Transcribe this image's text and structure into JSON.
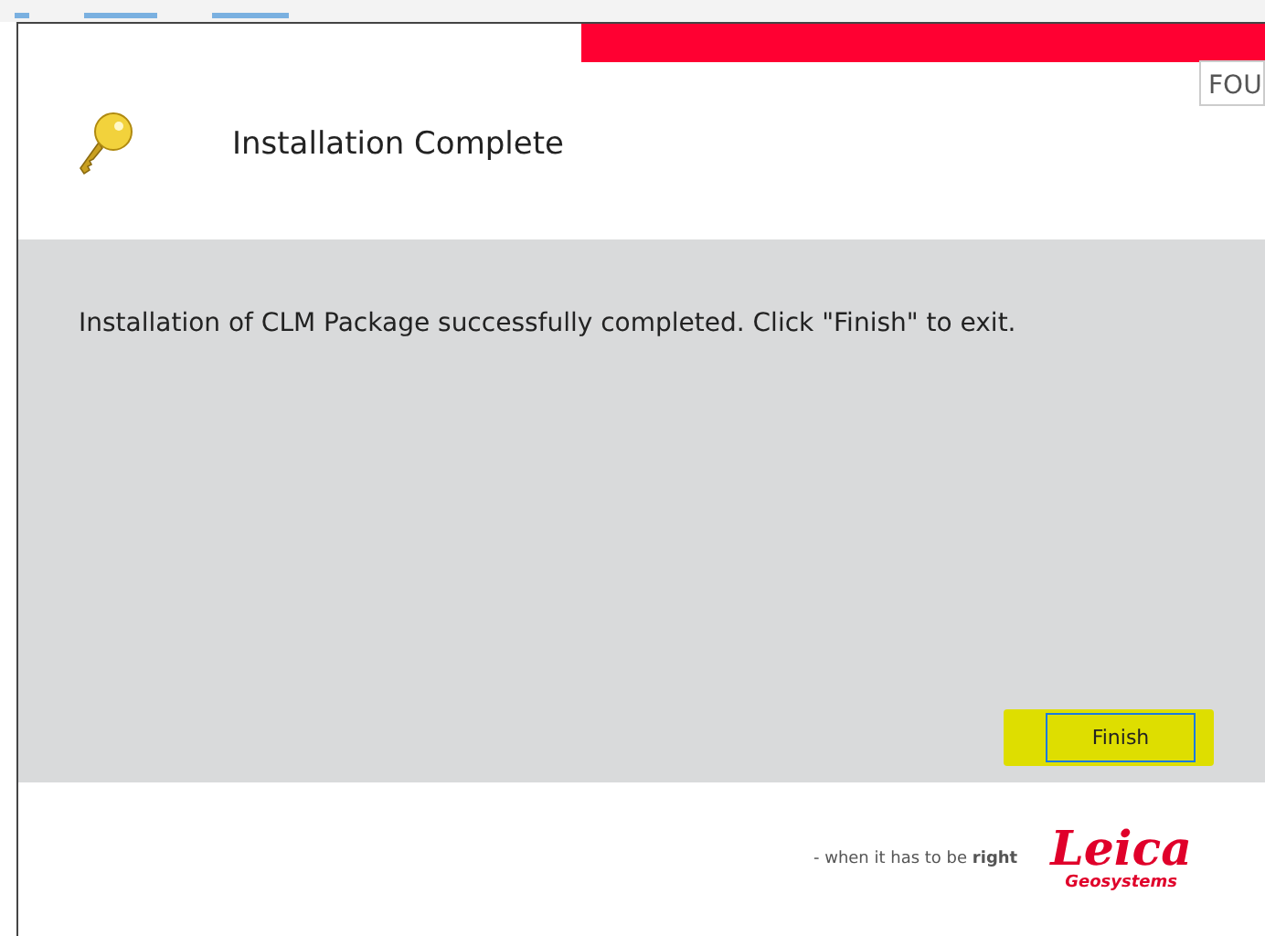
{
  "tooltip": {
    "text": "FOU"
  },
  "header": {
    "title": "Installation Complete"
  },
  "body": {
    "message": "Installation of CLM Package successfully completed. Click \"Finish\" to exit."
  },
  "buttons": [
    {
      "label": "Finish",
      "focused": true
    }
  ],
  "footer": {
    "tagline": "- when it has to be **right**",
    "logo": "Leica",
    "logo_sub": "Geosystems"
  }
}
